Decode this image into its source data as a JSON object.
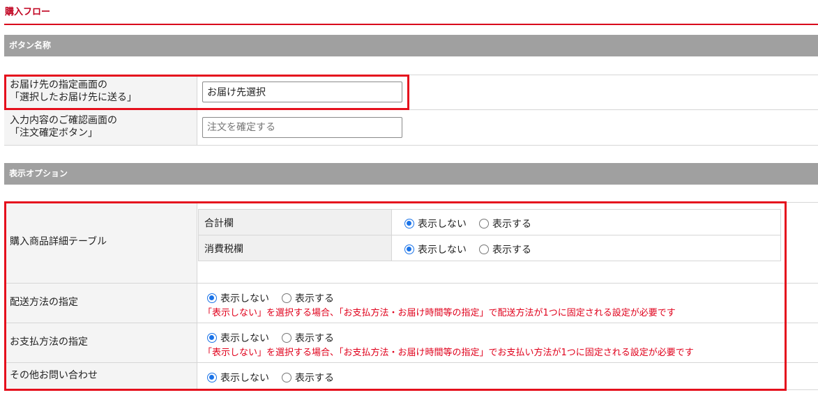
{
  "page": {
    "title": "購入フロー"
  },
  "sections": {
    "button_names": "ボタン名称",
    "display_options": "表示オプション"
  },
  "button_rows": [
    {
      "label_line1": "お届け先の指定画面の",
      "label_line2": "「選択したお届け先に送る」",
      "value": "お届け先選択",
      "placeholder": ""
    },
    {
      "label_line1": "入力内容のご確認画面の",
      "label_line2": "「注文確定ボタン」",
      "value": "",
      "placeholder": "注文を確定する"
    }
  ],
  "radio_labels": {
    "hide": "表示しない",
    "show": "表示する"
  },
  "option_rows": {
    "detail_table": {
      "label": "購入商品詳細テーブル",
      "sub_rows": [
        {
          "label": "合計欄",
          "selected": "hide"
        },
        {
          "label": "消費税欄",
          "selected": "hide"
        }
      ]
    },
    "delivery_method": {
      "label": "配送方法の指定",
      "selected": "hide",
      "note": "「表示しない」を選択する場合、「お支払方法・お届け時間等の指定」で配送方法が1つに固定される設定が必要です"
    },
    "payment_method": {
      "label": "お支払方法の指定",
      "selected": "hide",
      "note": "「表示しない」を選択する場合、「お支払方法・お届け時間等の指定」でお支払い方法が1つに固定される設定が必要です"
    },
    "other_inquiry": {
      "label": "その他お問い合わせ",
      "selected": "hide"
    }
  },
  "colors": {
    "accent_red": "#e5101d",
    "header_gray": "#a0a0a0",
    "radio_blue": "#1a73e8"
  }
}
